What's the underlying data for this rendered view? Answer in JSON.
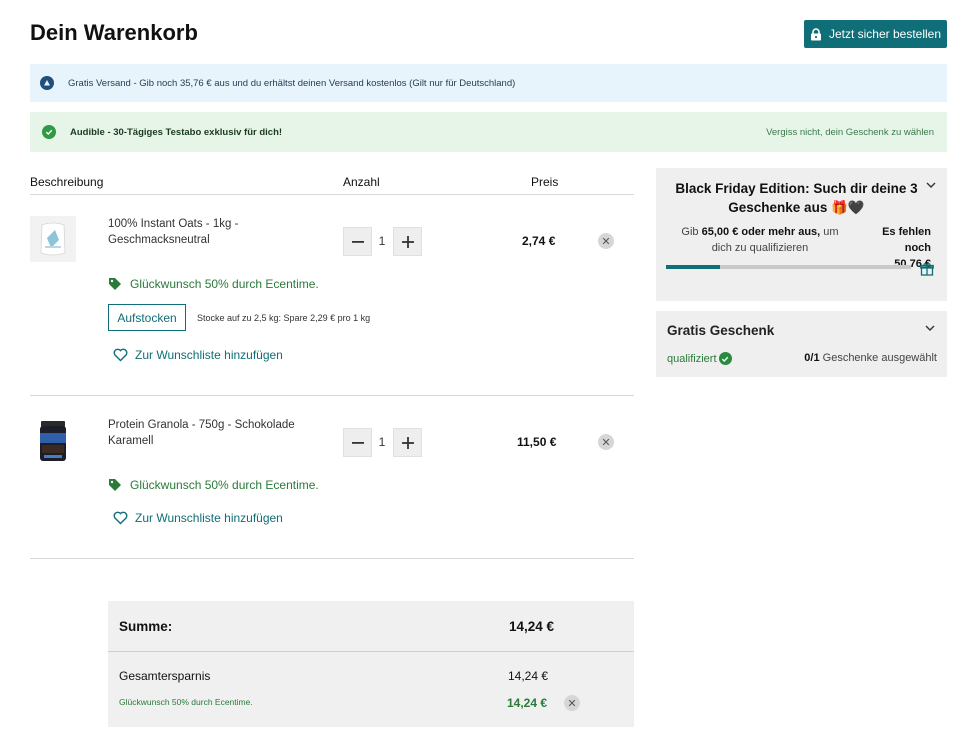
{
  "page": {
    "title": "Dein Warenkorb",
    "checkout_label": "Jetzt sicher bestellen"
  },
  "banners": {
    "shipping_text": "Gratis Versand - Gib noch 35,76 € aus und du erhältst deinen Versand kostenlos (Gilt nur für Deutschland)",
    "audible_text": "Audible - 30-Tägiges Testabo exklusiv für dich!",
    "audible_link": "Vergiss nicht, dein Geschenk zu wählen"
  },
  "cart": {
    "headers": {
      "description": "Beschreibung",
      "quantity": "Anzahl",
      "price": "Preis"
    },
    "items": [
      {
        "name": "100% Instant Oats - 1kg - Geschmacksneutral",
        "quantity": "1",
        "price": "2,74 €",
        "promo": "Glückwunsch 50% durch Ecentime.",
        "restock_label": "Aufstocken",
        "restock_note": "Stocke auf zu 2,5 kg: Spare 2,29 € pro 1 kg",
        "wishlist_label": "Zur Wunschliste hinzufügen"
      },
      {
        "name": "Protein Granola - 750g - Schokolade Karamell",
        "quantity": "1",
        "price": "11,50 €",
        "promo": "Glückwunsch 50% durch Ecentime.",
        "wishlist_label": "Zur Wunschliste hinzufügen"
      }
    ]
  },
  "summary": {
    "total_label": "Summe:",
    "total_value": "14,24 €",
    "savings_label": "Gesamtersparnis",
    "savings_value": "14,24 €",
    "promo_label": "Glückwunsch 50% durch Ecentime.",
    "promo_value": "14,24 €"
  },
  "sidebar": {
    "gift_title": "Black Friday Edition: Such dir deine 3 Geschenke aus",
    "gift_title_emoji": "🎁🖤",
    "spend_prefix": "Gib",
    "spend_amount": "65,00 € oder mehr aus,",
    "spend_suffix": "um dich zu qualifizieren",
    "missing_label": "Es fehlen noch",
    "missing_value": "50,76 €",
    "progress_fraction": 0.22,
    "free_gift_title": "Gratis Geschenk",
    "qualified_label": "qualifiziert",
    "gifts_selected": "0/1",
    "gifts_selected_label": "Geschenke ausgewählt"
  },
  "colors": {
    "accent": "#0f6e77",
    "success": "#2a7a3a",
    "info_bg": "#e8f4fc",
    "success_bg": "#e7f5e9"
  }
}
